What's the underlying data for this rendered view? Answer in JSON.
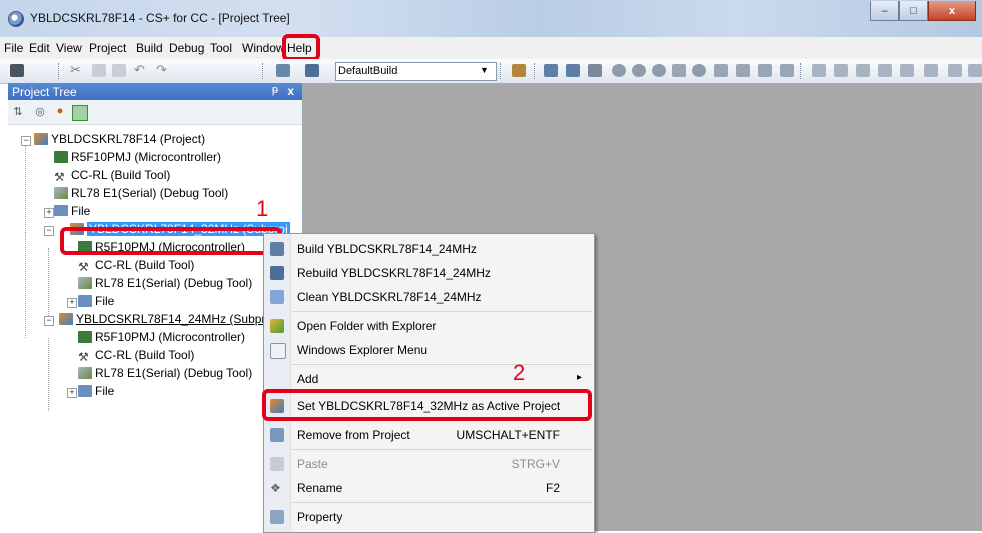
{
  "window": {
    "title": "YBLDCSKRL78F14 - CS+ for CC - [Project Tree]",
    "min": "–",
    "max": "□",
    "close": "x"
  },
  "menu": [
    "File",
    "Edit",
    "View",
    "Project",
    "Build",
    "Debug",
    "Tool",
    "Window",
    "Help"
  ],
  "toolbar": {
    "build_config": "DefaultBuild"
  },
  "panel": {
    "title": "Project Tree",
    "pin": "ᵽ",
    "close": "x"
  },
  "tree": [
    {
      "label": "YBLDCSKRL78F14 (Project)"
    },
    {
      "label": "R5F10PMJ (Microcontroller)"
    },
    {
      "label": "CC-RL (Build Tool)"
    },
    {
      "label": "RL78 E1(Serial) (Debug Tool)"
    },
    {
      "label": "File"
    },
    {
      "label": "YBLDCSKRL78F14_32MHz (Subproj"
    },
    {
      "label": "R5F10PMJ (Microcontroller)"
    },
    {
      "label": "CC-RL (Build Tool)"
    },
    {
      "label": "RL78 E1(Serial) (Debug Tool)"
    },
    {
      "label": "File"
    },
    {
      "label": "YBLDCSKRL78F14_24MHz (Subproj"
    },
    {
      "label": "R5F10PMJ (Microcontroller)"
    },
    {
      "label": "CC-RL (Build Tool)"
    },
    {
      "label": "RL78 E1(Serial) (Debug Tool)"
    },
    {
      "label": "File"
    }
  ],
  "context_menu": [
    {
      "label": "Build YBLDCSKRL78F14_24MHz"
    },
    {
      "label": "Rebuild YBLDCSKRL78F14_24MHz"
    },
    {
      "label": "Clean YBLDCSKRL78F14_24MHz"
    },
    {
      "label": "Open Folder with Explorer"
    },
    {
      "label": "Windows Explorer Menu"
    },
    {
      "label": "Add",
      "submenu": "▸"
    },
    {
      "label": "Set YBLDCSKRL78F14_32MHz as Active Project"
    },
    {
      "label": "Remove from Project",
      "shortcut": "UMSCHALT+ENTF"
    },
    {
      "label": "Paste",
      "shortcut": "STRG+V",
      "disabled": true
    },
    {
      "label": "Rename",
      "shortcut": "F2"
    },
    {
      "label": "Property"
    }
  ],
  "annotations": {
    "step1": "1",
    "step2": "2"
  },
  "colors": {
    "highlight": "#e2001a",
    "selection": "#3399ff",
    "workspace": "#a9a9a9",
    "panel_header": "#4a7bcb"
  }
}
